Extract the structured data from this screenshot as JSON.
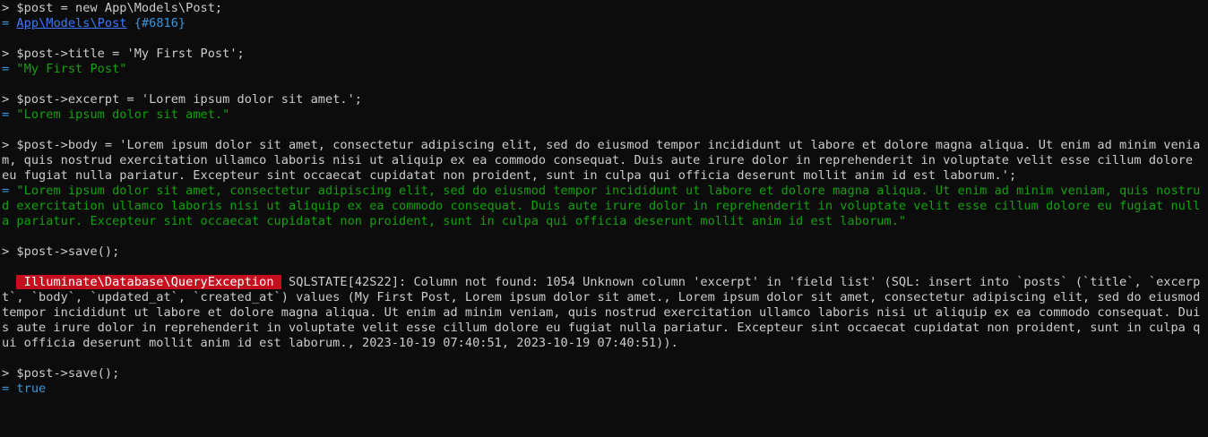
{
  "prompt_symbol": "> ",
  "result_symbol": "= ",
  "blocks": [
    {
      "command": "$post = new App\\Models\\Post;",
      "result_class": "App\\Models\\Post",
      "result_id": "{#6816}"
    },
    {
      "command": "$post->title = 'My First Post';",
      "result": "\"My First Post\""
    },
    {
      "command": "$post->excerpt = 'Lorem ipsum dolor sit amet.';",
      "result": "\"Lorem ipsum dolor sit amet.\""
    },
    {
      "command": "$post->body = 'Lorem ipsum dolor sit amet, consectetur adipiscing elit, sed do eiusmod tempor incididunt ut labore et dolore magna aliqua. Ut enim ad minim veniam, quis nostrud exercitation ullamco laboris nisi ut aliquip ex ea commodo consequat. Duis aute irure dolor in reprehenderit in voluptate velit esse cillum dolore eu fugiat nulla pariatur. Excepteur sint occaecat cupidatat non proident, sunt in culpa qui officia deserunt mollit anim id est laborum.';",
      "result": "\"Lorem ipsum dolor sit amet, consectetur adipiscing elit, sed do eiusmod tempor incididunt ut labore et dolore magna aliqua. Ut enim ad minim veniam, quis nostrud exercitation ullamco laboris nisi ut aliquip ex ea commodo consequat. Duis aute irure dolor in reprehenderit in voluptate velit esse cillum dolore eu fugiat nulla pariatur. Excepteur sint occaecat cupidatat non proident, sunt in culpa qui officia deserunt mollit anim id est laborum.\""
    },
    {
      "command": "$post->save();",
      "exception_class": " Illuminate\\Database\\QueryException ",
      "exception_message": " SQLSTATE[42S22]: Column not found: 1054 Unknown column 'excerpt' in 'field list' (SQL: insert into `posts` (`title`, `excerpt`, `body`, `updated_at`, `created_at`) values (My First Post, Lorem ipsum dolor sit amet., Lorem ipsum dolor sit amet, consectetur adipiscing elit, sed do eiusmod tempor incididunt ut labore et dolore magna aliqua. Ut enim ad minim veniam, quis nostrud exercitation ullamco laboris nisi ut aliquip ex ea commodo consequat. Duis aute irure dolor in reprehenderit in voluptate velit esse cillum dolore eu fugiat nulla pariatur. Excepteur sint occaecat cupidatat non proident, sunt in culpa qui officia deserunt mollit anim id est laborum., 2023-10-19 07:40:51, 2023-10-19 07:40:51))."
    },
    {
      "command": "$post->save();",
      "result": "true"
    }
  ],
  "colors": {
    "background": "#0c0c0c",
    "foreground": "#cccccc",
    "string": "#13a10e",
    "link": "#3b78ff",
    "marker": "#3a96dd",
    "exception_bg": "#c50f1f"
  }
}
